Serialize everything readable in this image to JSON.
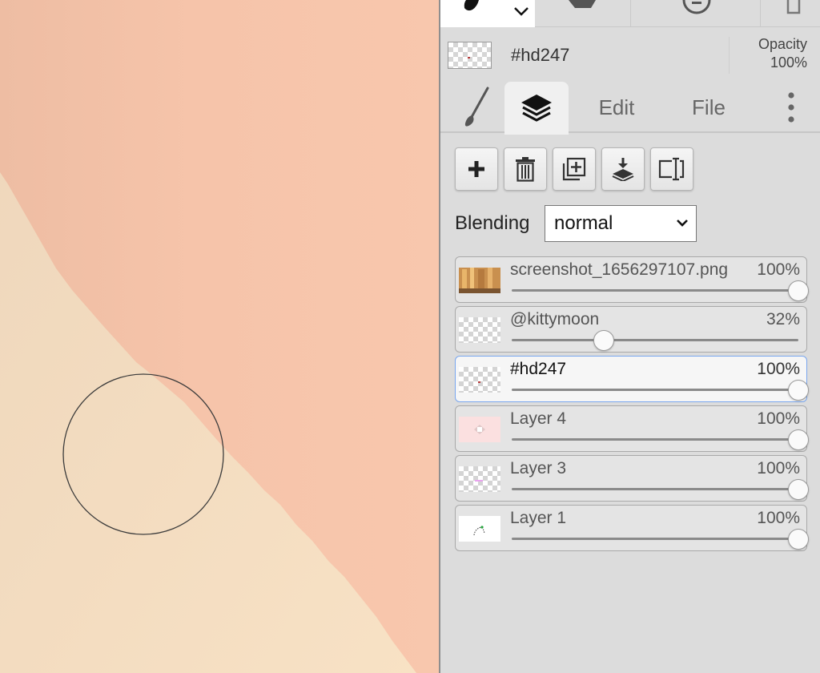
{
  "colors": {
    "canvas_light": "#f6dfc3",
    "canvas_peach": "#f7c5ab",
    "panel_bg": "#dcdcdc",
    "selection_border": "#79a6ee"
  },
  "toolbar": {
    "tools": [
      {
        "icon": "brush-icon"
      },
      {
        "icon": "shape-icon"
      },
      {
        "icon": "eraser-icon"
      },
      {
        "icon": "document-icon"
      }
    ]
  },
  "header": {
    "layer_name": "#hd247",
    "opacity_label": "Opacity",
    "opacity_value": "100%"
  },
  "tabs": {
    "brush_icon": "brush-icon",
    "layers_icon": "layers-icon",
    "edit_label": "Edit",
    "file_label": "File",
    "more_icon": "more-vertical-icon"
  },
  "layer_tools": [
    {
      "name": "add-layer",
      "icon": "plus-icon"
    },
    {
      "name": "delete-layer",
      "icon": "trash-icon"
    },
    {
      "name": "duplicate-layer",
      "icon": "duplicate-icon"
    },
    {
      "name": "merge-down",
      "icon": "merge-down-icon"
    },
    {
      "name": "rename-layer",
      "icon": "rename-icon"
    }
  ],
  "blending": {
    "label": "Blending",
    "value": "normal"
  },
  "layers": [
    {
      "name": "screenshot_1656297107.png",
      "opacity": "100%",
      "opacity_fraction": 1.0,
      "selected": false,
      "thumb": "image"
    },
    {
      "name": "@kittymoon",
      "opacity": "32%",
      "opacity_fraction": 0.32,
      "selected": false,
      "thumb": "transparent"
    },
    {
      "name": "#hd247",
      "opacity": "100%",
      "opacity_fraction": 1.0,
      "selected": true,
      "thumb": "transparent-dot"
    },
    {
      "name": "Layer 4",
      "opacity": "100%",
      "opacity_fraction": 1.0,
      "selected": false,
      "thumb": "pink"
    },
    {
      "name": "Layer 3",
      "opacity": "100%",
      "opacity_fraction": 1.0,
      "selected": false,
      "thumb": "transparent-marks"
    },
    {
      "name": "Layer 1",
      "opacity": "100%",
      "opacity_fraction": 1.0,
      "selected": false,
      "thumb": "white-sketch"
    }
  ]
}
